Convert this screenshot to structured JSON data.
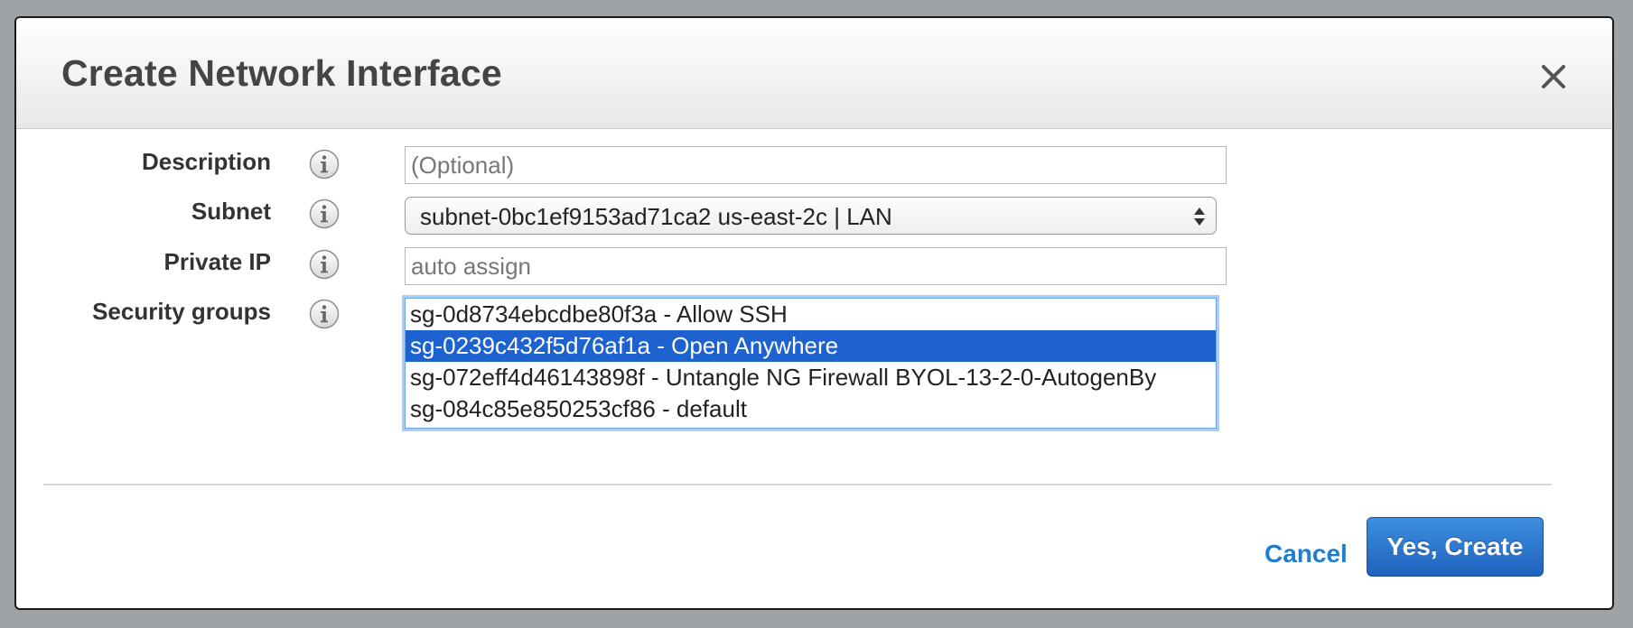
{
  "dialog": {
    "title": "Create Network Interface",
    "close_icon": "close-icon"
  },
  "form": {
    "description": {
      "label": "Description",
      "placeholder": "(Optional)",
      "value": "",
      "info_icon": "info-icon"
    },
    "subnet": {
      "label": "Subnet",
      "selected": "subnet-0bc1ef9153ad71ca2 us-east-2c | LAN",
      "info_icon": "info-icon",
      "arrow_icon": "select-arrows-icon"
    },
    "private_ip": {
      "label": "Private IP",
      "placeholder": "auto assign",
      "value": "",
      "info_icon": "info-icon"
    },
    "security_groups": {
      "label": "Security groups",
      "info_icon": "info-icon",
      "options": [
        {
          "text": "sg-0d8734ebcdbe80f3a - Allow SSH",
          "selected": false
        },
        {
          "text": "sg-0239c432f5d76af1a - Open Anywhere",
          "selected": true
        },
        {
          "text": "sg-072eff4d46143898f - Untangle NG Firewall BYOL-13-2-0-AutogenBy",
          "selected": false
        },
        {
          "text": "sg-084c85e850253cf86 - default",
          "selected": false
        }
      ]
    }
  },
  "footer": {
    "cancel_label": "Cancel",
    "confirm_label": "Yes, Create"
  },
  "colors": {
    "accent": "#1f7ed1",
    "selection": "#1e62d0",
    "primary_button": "#2a72cc",
    "backdrop": "#9ea3a8"
  }
}
